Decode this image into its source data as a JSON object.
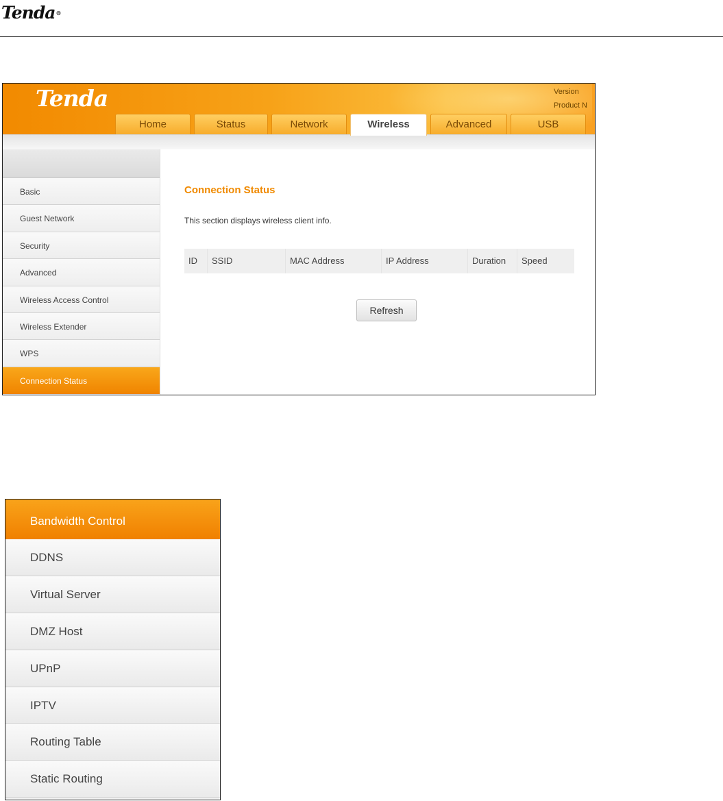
{
  "document": {
    "logo": "Tenda",
    "logo_mark": "®"
  },
  "router": {
    "logo": "Tenda",
    "version_lines": [
      "Version",
      "Product N"
    ],
    "tabs": [
      {
        "label": "Home",
        "active": false
      },
      {
        "label": "Status",
        "active": false
      },
      {
        "label": "Network",
        "active": false
      },
      {
        "label": "Wireless",
        "active": true
      },
      {
        "label": "Advanced",
        "active": false
      },
      {
        "label": "USB",
        "active": false
      }
    ],
    "sidebar": [
      {
        "label": "Basic",
        "active": false
      },
      {
        "label": "Guest Network",
        "active": false
      },
      {
        "label": "Security",
        "active": false
      },
      {
        "label": "Advanced",
        "active": false
      },
      {
        "label": "Wireless Access Control",
        "active": false
      },
      {
        "label": "Wireless Extender",
        "active": false
      },
      {
        "label": "WPS",
        "active": false
      },
      {
        "label": "Connection Status",
        "active": true
      }
    ],
    "content": {
      "title": "Connection Status",
      "description": "This section displays wireless client info.",
      "columns": [
        "ID",
        "SSID",
        "MAC Address",
        "IP Address",
        "Duration",
        "Speed"
      ],
      "refresh_label": "Refresh"
    }
  },
  "advanced_menu": [
    {
      "label": "Bandwidth Control",
      "active": true
    },
    {
      "label": "DDNS",
      "active": false
    },
    {
      "label": "Virtual Server",
      "active": false
    },
    {
      "label": "DMZ Host",
      "active": false
    },
    {
      "label": "UPnP",
      "active": false
    },
    {
      "label": "IPTV",
      "active": false
    },
    {
      "label": "Routing Table",
      "active": false
    },
    {
      "label": "Static Routing",
      "active": false
    }
  ],
  "colors": {
    "accent_orange": "#f08a00",
    "banner_orange": "#f7a218"
  }
}
